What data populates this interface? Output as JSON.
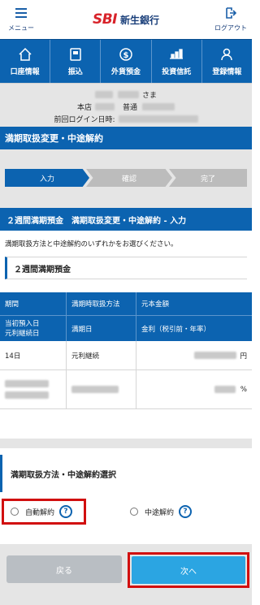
{
  "header": {
    "menu_label": "メニュー",
    "brand_sbi": "SBI",
    "brand_name": "新生銀行",
    "logout_label": "ログアウト"
  },
  "nav": [
    {
      "label": "口座情報",
      "icon": "home-icon"
    },
    {
      "label": "振込",
      "icon": "transfer-icon"
    },
    {
      "label": "外貨預金",
      "icon": "dollar-coin-icon"
    },
    {
      "label": "投資信託",
      "icon": "investment-icon"
    },
    {
      "label": "登録情報",
      "icon": "person-icon"
    }
  ],
  "account": {
    "name_suffix": "さま",
    "branch_label": "本店",
    "type_label": "普通",
    "last_login_label": "前回ログイン日時:"
  },
  "page_title": "満期取扱変更・中途解約",
  "steps": [
    "入力",
    "確認",
    "完了"
  ],
  "section_title": "２週間満期預金　満期取扱変更・中途解約 - 入力",
  "instruction": "満期取扱方法と中途解約のいずれかをお選びください。",
  "product_heading": "２週間満期預金",
  "table": {
    "headers_row1": [
      "期間",
      "満期時取扱方法",
      "元本金額"
    ],
    "headers_row2": [
      "当初預入日\n元利継続日",
      "満期日",
      "金利（税引前・年率）"
    ],
    "row1": {
      "period": "14日",
      "method": "元利継続",
      "unit": "円"
    },
    "row2": {
      "unit": "%"
    }
  },
  "selection_heading": "満期取扱方法・中途解約選択",
  "options": [
    {
      "label": "自動解約"
    },
    {
      "label": "中途解約"
    }
  ],
  "buttons": {
    "back": "戻る",
    "next": "次へ"
  },
  "colors": {
    "primary": "#0c63b0",
    "accent_next": "#2ba5e2",
    "highlight": "#d10f0f"
  }
}
